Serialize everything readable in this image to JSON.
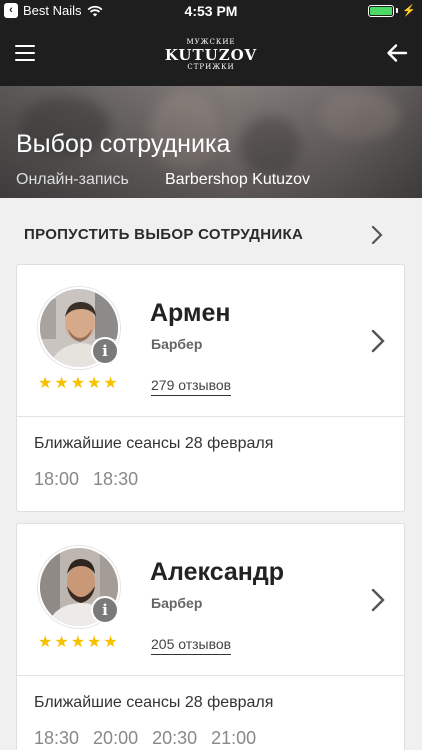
{
  "status_bar": {
    "back_app": "Best Nails",
    "time": "4:53 PM",
    "battery_percent": 100
  },
  "nav": {
    "menu_icon": "hamburger-icon",
    "back_icon": "arrow-left-icon",
    "logo": {
      "top": "МУЖСКИЕ",
      "main": "KUTUZOV",
      "bottom": "СТРИЖКИ"
    }
  },
  "hero": {
    "title": "Выбор сотрудника",
    "subtitle_left": "Онлайн-запись",
    "subtitle_right": "Barbershop Kutuzov"
  },
  "skip": {
    "label": "ПРОПУСТИТЬ ВЫБОР СОТРУДНИКА"
  },
  "staff": [
    {
      "name": "Армен",
      "role": "Барбер",
      "rating": 5,
      "reviews": "279 отзывов",
      "sessions_label": "Ближайшие сеансы 28 февраля",
      "slots": [
        "18:00",
        "18:30"
      ]
    },
    {
      "name": "Александр",
      "role": "Барбер",
      "rating": 5,
      "reviews": "205 отзывов",
      "sessions_label": "Ближайшие сеансы 28 февраля",
      "slots": [
        "18:30",
        "20:00",
        "20:30",
        "21:00"
      ]
    }
  ],
  "colors": {
    "star": "#f6c200",
    "battery": "#4cd964",
    "bar": "#1e1e1e"
  }
}
